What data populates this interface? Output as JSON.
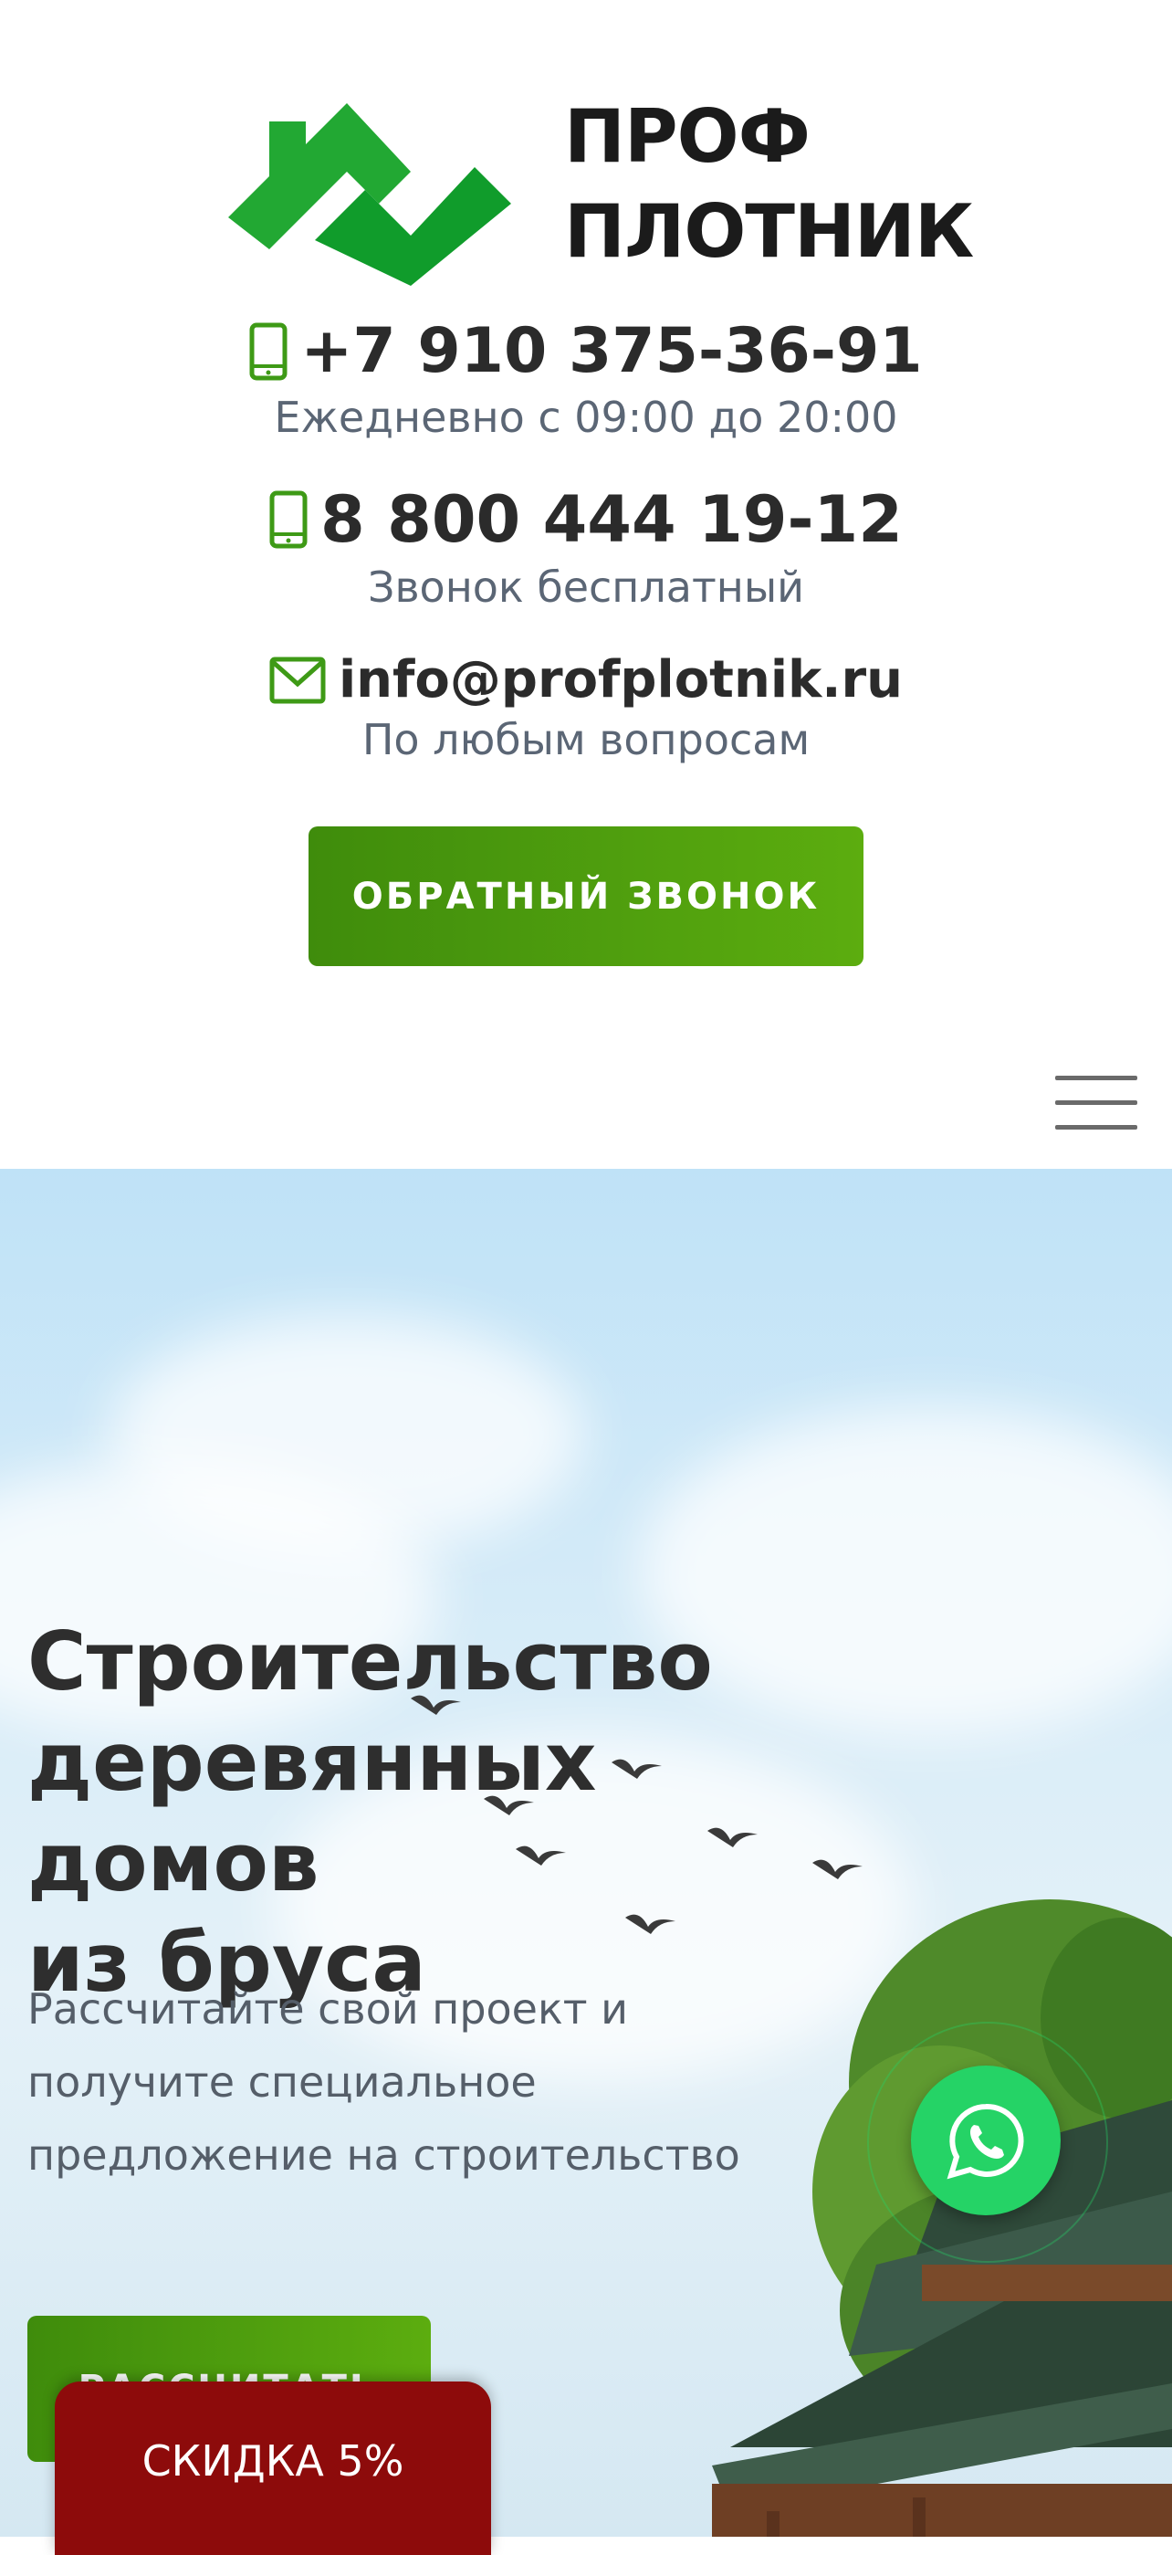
{
  "logo": {
    "line1": "ПРОФ",
    "line2": "ПЛОТНИК",
    "brand_green": "#1fa82f"
  },
  "contacts": [
    {
      "icon": "phone-icon",
      "value": "+7 910 375-36-91",
      "note": "Ежедневно с 09:00 до 20:00"
    },
    {
      "icon": "phone-icon",
      "value": "8 800 444 19-12",
      "note": "Звонок бесплатный"
    },
    {
      "icon": "mail-icon",
      "value": "info@profplotnik.ru",
      "note": "По любым вопросам"
    }
  ],
  "callback_button": "ОБРАТНЫЙ ЗВОНОК",
  "hero": {
    "title": [
      "Строительство",
      "деревянных домов",
      "из бруса"
    ],
    "subtitle": [
      "Рассчитайте свой проект и",
      "получите специальное",
      "предложение на строительство"
    ],
    "calc_button": "РАССЧИТАТЬ"
  },
  "discount_tab": "СКИДКА 5%",
  "colors": {
    "accent_green": "#4e9e0e",
    "discount_red": "#8d0b0b",
    "whatsapp": "#25d366"
  }
}
